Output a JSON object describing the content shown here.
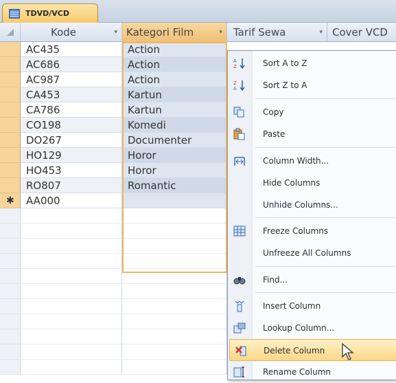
{
  "tab": {
    "title": "TDVD/VCD",
    "icon": "table-icon"
  },
  "header": {
    "columns": [
      {
        "label": "Kode"
      },
      {
        "label": "Kategori Film"
      },
      {
        "label": "Tarif Sewa"
      },
      {
        "label": "Cover VCD"
      }
    ],
    "dropdown_glyph": "▾"
  },
  "rows": [
    {
      "kode": "AC435",
      "kategori": "Action"
    },
    {
      "kode": "AC686",
      "kategori": "Action"
    },
    {
      "kode": "AC987",
      "kategori": "Action"
    },
    {
      "kode": "CA453",
      "kategori": "Kartun"
    },
    {
      "kode": "CA786",
      "kategori": "Kartun"
    },
    {
      "kode": "CO198",
      "kategori": "Komedi"
    },
    {
      "kode": "DO267",
      "kategori": "Documenter"
    },
    {
      "kode": "HO129",
      "kategori": "Horor"
    },
    {
      "kode": "HO453",
      "kategori": "Horor"
    },
    {
      "kode": "RO807",
      "kategori": "Romantic"
    }
  ],
  "new_row": {
    "marker": "✱",
    "kode": "AA000",
    "kategori": ""
  },
  "context_menu": {
    "items": [
      {
        "label": "Sort A to Z",
        "icon": "sort-ascending-icon"
      },
      {
        "label": "Sort Z to A",
        "icon": "sort-descending-icon"
      },
      {
        "label": "Copy",
        "icon": "copy-icon"
      },
      {
        "label": "Paste",
        "icon": "paste-icon"
      },
      {
        "label": "Column Width...",
        "icon": "column-width-icon"
      },
      {
        "label": "Hide Columns",
        "icon": ""
      },
      {
        "label": "Unhide Columns...",
        "icon": ""
      },
      {
        "label": "Freeze Columns",
        "icon": "freeze-columns-icon"
      },
      {
        "label": "Unfreeze All Columns",
        "icon": ""
      },
      {
        "label": "Find...",
        "icon": "find-icon"
      },
      {
        "label": "Insert Column",
        "icon": "insert-column-icon"
      },
      {
        "label": "Lookup Column...",
        "icon": "lookup-column-icon"
      },
      {
        "label": "Delete Column",
        "icon": "delete-column-icon",
        "highlighted": true
      },
      {
        "label": "Rename Column",
        "icon": "rename-column-icon"
      }
    ]
  },
  "colors": {
    "selected_column": "#dde5f1",
    "selected_header": "#f9d89d",
    "menu_highlight": "#fbd786",
    "row_selector": "#f7d59a"
  }
}
